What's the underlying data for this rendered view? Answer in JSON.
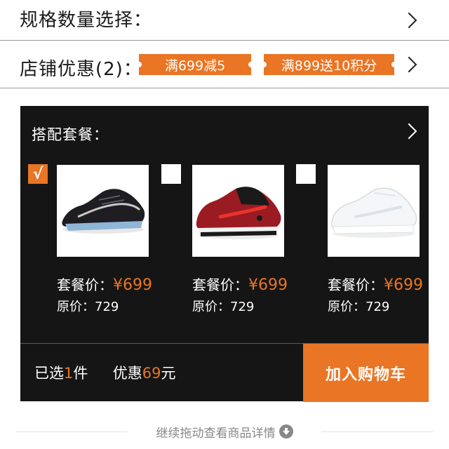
{
  "spec_row": {
    "label": "规格数量选择："
  },
  "shop_row": {
    "label": "店铺优惠(2)：",
    "coupons": [
      "满699减5",
      "满899送10积分"
    ]
  },
  "bundle": {
    "title": "搭配套餐：",
    "price_label": "套餐价：",
    "orig_label": "原价：",
    "items": [
      {
        "checked": true,
        "check_mark": "√",
        "price": "¥699",
        "orig": "729",
        "shoe": "black-running-shoe"
      },
      {
        "checked": false,
        "check_mark": "",
        "price": "¥699",
        "orig": "729",
        "shoe": "red-black-sneaker"
      },
      {
        "checked": false,
        "check_mark": "",
        "price": "¥699",
        "orig": "729",
        "shoe": "white-sneaker"
      }
    ],
    "footer": {
      "selected_prefix": "已选",
      "selected_count": "1",
      "selected_unit": "件",
      "discount_prefix": "优惠",
      "discount_value": "69",
      "discount_unit": "元",
      "cart_button": "加入购物车"
    }
  },
  "more": {
    "label": "继续拖动查看商品详情",
    "icon": "arrow-down-circle-icon"
  },
  "colors": {
    "accent": "#e97525",
    "panel_bg": "#151515",
    "text": "#1a1a1a",
    "muted": "#888888"
  }
}
